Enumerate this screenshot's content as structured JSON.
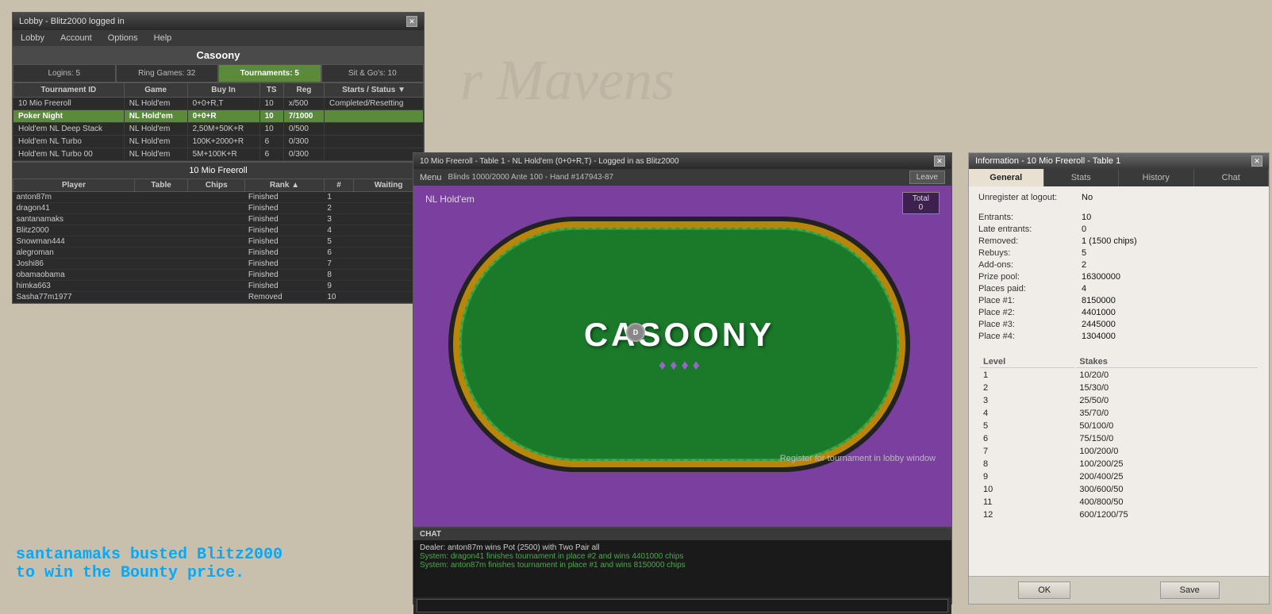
{
  "watermark": {
    "text": "r Mavens"
  },
  "lobby": {
    "title": "Lobby - Blitz2000 logged in",
    "casoony_title": "Casoony",
    "menu_items": [
      "Lobby",
      "Account",
      "Options",
      "Help"
    ],
    "tabs": [
      {
        "label": "Logins: 5",
        "active": false
      },
      {
        "label": "Ring Games: 32",
        "active": false
      },
      {
        "label": "Tournaments: 5",
        "active": true
      },
      {
        "label": "Sit & Go's: 10",
        "active": false
      }
    ],
    "tournament_columns": [
      "Tournament ID",
      "Game",
      "Buy In",
      "TS",
      "Reg",
      "Starts / Status ▼"
    ],
    "tournaments": [
      {
        "id": "10 Mio Freeroll",
        "game": "NL Hold'em",
        "buyin": "0+0+R,T",
        "ts": "10",
        "reg": "x/500",
        "status": "Completed/Resetting",
        "selected": false
      },
      {
        "id": "Poker Night",
        "game": "NL Hold'em",
        "buyin": "0+0+R",
        "ts": "10",
        "reg": "7/1000",
        "status": "",
        "selected": true,
        "highlight": true
      },
      {
        "id": "Hold'em NL Deep Stack",
        "game": "NL Hold'em",
        "buyin": "2,50M+50K+R",
        "ts": "10",
        "reg": "0/500",
        "status": "",
        "selected": false
      },
      {
        "id": "Hold'em NL Turbo",
        "game": "NL Hold'em",
        "buyin": "100K+2000+R",
        "ts": "6",
        "reg": "0/300",
        "status": "",
        "selected": false
      },
      {
        "id": "Hold'em NL Turbo 00",
        "game": "NL Hold'em",
        "buyin": "5M+100K+R",
        "ts": "6",
        "reg": "0/300",
        "status": "",
        "selected": false
      }
    ],
    "players_section_title": "10 Mio Freeroll",
    "player_columns": [
      "Player",
      "Table",
      "Chips",
      "Rank ▲",
      "#",
      "Waiting"
    ],
    "players": [
      {
        "name": "anton87m",
        "table": "",
        "chips": "",
        "status": "Finished",
        "rank": "1",
        "num": "",
        "waiting": ""
      },
      {
        "name": "dragon41",
        "table": "",
        "chips": "",
        "status": "Finished",
        "rank": "2",
        "num": "",
        "waiting": ""
      },
      {
        "name": "santanamaks",
        "table": "",
        "chips": "",
        "status": "Finished",
        "rank": "3",
        "num": "",
        "waiting": ""
      },
      {
        "name": "Blitz2000",
        "table": "",
        "chips": "",
        "status": "Finished",
        "rank": "4",
        "num": "",
        "waiting": ""
      },
      {
        "name": "Snowman444",
        "table": "",
        "chips": "",
        "status": "Finished",
        "rank": "5",
        "num": "",
        "waiting": ""
      },
      {
        "name": "alegroman",
        "table": "",
        "chips": "",
        "status": "Finished",
        "rank": "6",
        "num": "",
        "waiting": ""
      },
      {
        "name": "Joshi86",
        "table": "",
        "chips": "",
        "status": "Finished",
        "rank": "7",
        "num": "",
        "waiting": ""
      },
      {
        "name": "obamaobama",
        "table": "",
        "chips": "",
        "status": "Finished",
        "rank": "8",
        "num": "",
        "waiting": ""
      },
      {
        "name": "himka663",
        "table": "",
        "chips": "",
        "status": "Finished",
        "rank": "9",
        "num": "",
        "waiting": ""
      },
      {
        "name": "Sasha77m1977",
        "table": "",
        "chips": "",
        "status": "Removed",
        "rank": "10",
        "num": "",
        "waiting": ""
      }
    ]
  },
  "table_window": {
    "title": "10 Mio Freeroll - Table 1 - NL Hold'em (0+0+R,T) - Logged in as Blitz2000",
    "blind_info": "Blinds 1000/2000 Ante 100 - Hand #147943-87",
    "menu_label": "Menu",
    "leave_label": "Leave",
    "game_type": "NL Hold'em",
    "total_label": "Total",
    "total_value": "0",
    "casoony_logo": "CASOONY",
    "dealer_btn": "D",
    "register_text": "Register for tournament in lobby window",
    "chat_header": "CHAT",
    "chat_messages": [
      {
        "type": "normal",
        "text": "Dealer: anton87m wins Pot (2500) with Two Pair all"
      },
      {
        "type": "system",
        "text": "System: dragon41 finishes tournament in place #2 and wins 4401000 chips"
      },
      {
        "type": "system",
        "text": "System: anton87m finishes tournament in place #1 and wins 8150000 chips"
      }
    ]
  },
  "info_window": {
    "title": "Information - 10 Mio Freeroll - Table 1",
    "tabs": [
      "General",
      "Stats",
      "History",
      "Chat"
    ],
    "general": {
      "unregister_label": "Unregister at logout:",
      "unregister_value": "No",
      "entrants_label": "Entrants:",
      "entrants_value": "10",
      "late_label": "Late entrants:",
      "late_value": "0",
      "removed_label": "Removed:",
      "removed_value": "1 (1500 chips)",
      "rebuys_label": "Rebuys:",
      "rebuys_value": "5",
      "addons_label": "Add-ons:",
      "addons_value": "2",
      "prize_pool_label": "Prize pool:",
      "prize_pool_value": "16300000",
      "places_paid_label": "Places paid:",
      "places_paid_value": "4",
      "place1_label": "Place #1:",
      "place1_value": "8150000",
      "place2_label": "Place #2:",
      "place2_value": "4401000",
      "place3_label": "Place #3:",
      "place3_value": "2445000",
      "place4_label": "Place #4:",
      "place4_value": "1304000"
    },
    "levels": [
      {
        "level": "1",
        "stakes": "10/20/0"
      },
      {
        "level": "2",
        "stakes": "15/30/0"
      },
      {
        "level": "3",
        "stakes": "25/50/0"
      },
      {
        "level": "4",
        "stakes": "35/70/0"
      },
      {
        "level": "5",
        "stakes": "50/100/0"
      },
      {
        "level": "6",
        "stakes": "75/150/0"
      },
      {
        "level": "7",
        "stakes": "100/200/0"
      },
      {
        "level": "8",
        "stakes": "100/200/25"
      },
      {
        "level": "9",
        "stakes": "200/400/25"
      },
      {
        "level": "10",
        "stakes": "300/600/50"
      },
      {
        "level": "11",
        "stakes": "400/800/50"
      },
      {
        "level": "12",
        "stakes": "600/1200/75"
      }
    ],
    "levels_header_level": "Level",
    "levels_header_stakes": "Stakes",
    "ok_label": "OK",
    "save_label": "Save"
  },
  "bounty_message": {
    "line1": "santanamaks busted Blitz2000",
    "line2": "to win the Bounty price."
  }
}
